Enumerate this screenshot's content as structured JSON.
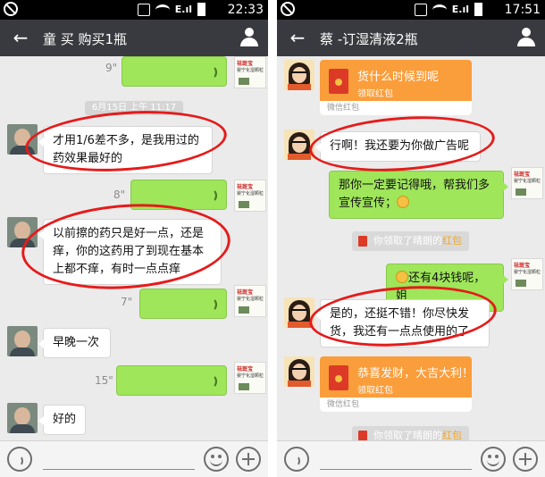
{
  "left": {
    "status": {
      "time": "22:33"
    },
    "chat_title": "童 买 购买1瓶",
    "messages": {
      "voice1_duration": "9\"",
      "timestamp": "6月15日 上午 11:17",
      "text1": "才用1/6差不多，是我用过的药效果最好的",
      "voice2_duration": "8\"",
      "text2": "以前擦的药只是好一点，还是痒，你的这药用了到现在基本上都不痒，有时一点点痒",
      "voice3_duration": "7\"",
      "text3": "早晚一次",
      "voice4_duration": "15\"",
      "text4": "好的"
    }
  },
  "right": {
    "status": {
      "time": "17:51"
    },
    "chat_title": "蔡 -订湿清液2瓶",
    "messages": {
      "redpacket1_text": "货什么时候到呢",
      "redpacket_sub": "领取红包",
      "redpacket_footer": "微信红包",
      "text1": "行啊！我还要为你做广告呢",
      "text2": "那你一定要记得哦，帮我们多宣传宣传；",
      "sys1_prefix": "你领取了晴朗的",
      "sys1_highlight": "红包",
      "text3": "还有4块钱呢，姐",
      "text4": "是的，还挺不错！你尽快发货，我还有一点点使用的了",
      "redpacket2_text": "恭喜发财，大吉大利！",
      "sys2_prefix": "你领取了晴朗的",
      "sys2_highlight": "红包"
    }
  },
  "sticker": {
    "brand": "祛斑宝",
    "line1": "婴宁化湿颗粒",
    "line2": "祛湿止痒"
  },
  "icons": {
    "back": "back-arrow-icon",
    "profile": "person-icon",
    "voice": "voice-wave-icon",
    "emoji": "emoji-icon",
    "plus": "plus-icon"
  },
  "colors": {
    "titlebar": "#393a3f",
    "sent_bubble": "#9fe65a",
    "annotation": "#e51b1b",
    "redpacket": "#fa9d3b"
  }
}
